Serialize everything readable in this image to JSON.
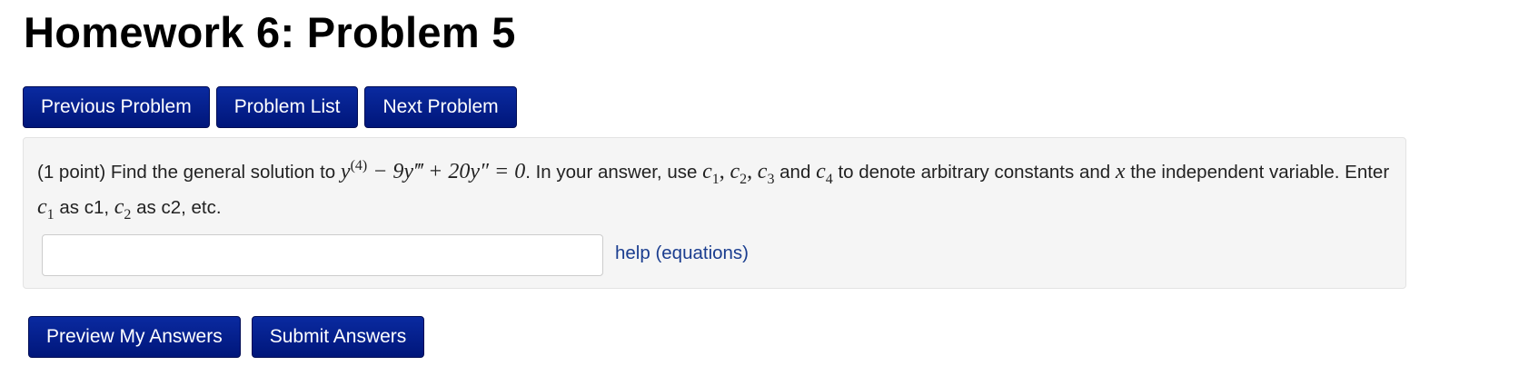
{
  "page": {
    "title": "Homework 6: Problem 5"
  },
  "nav": {
    "previous_label": "Previous Problem",
    "list_label": "Problem List",
    "next_label": "Next Problem"
  },
  "problem": {
    "intro": "(1 point) Find the general solution to",
    "equation": {
      "y": "y",
      "order4": "(4)",
      "minus": "−",
      "coef9": "9",
      "triple_prime": "‴",
      "plus": "+",
      "coef20": "20",
      "double_prime": "″",
      "equals": "=",
      "zero": "0"
    },
    "after_equation": ". In your answer, use",
    "const_c1": "c",
    "const_c1_sub": "1",
    "const_c2": "c",
    "const_c2_sub": "2",
    "const_c3": "c",
    "const_c3_sub": "3",
    "and_word": "and",
    "const_c4": "c",
    "const_c4_sub": "4",
    "to_denote": "to denote arbitrary constants and",
    "var_x": "x",
    "independent": "the independent variable. Enter",
    "enter_c1": "c",
    "enter_c1_sub": "1",
    "as_c1": "as c1,",
    "enter_c2": "c",
    "enter_c2_sub": "2",
    "as_c2": "as c2, etc.",
    "answer_value": "",
    "help_label": "help (equations)"
  },
  "actions": {
    "preview_label": "Preview My Answers",
    "submit_label": "Submit Answers"
  },
  "colors": {
    "button_bg": "#00167a",
    "panel_bg": "#f5f5f5",
    "link": "#1a3d8f"
  }
}
